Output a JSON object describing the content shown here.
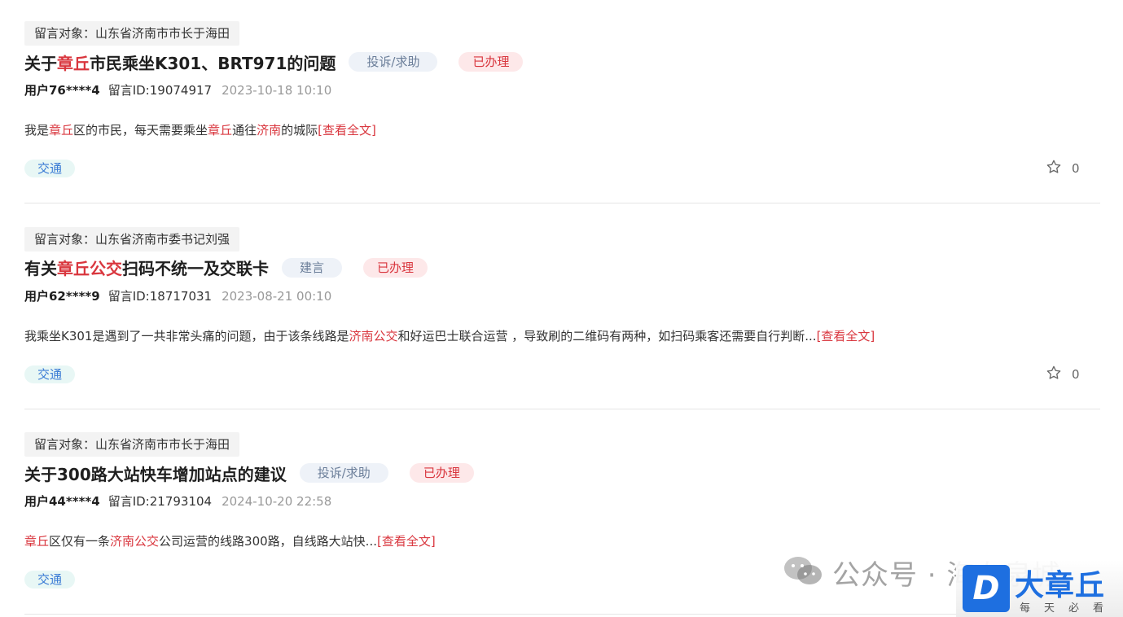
{
  "posts": [
    {
      "target": "留言对象：山东省济南市市长于海田",
      "title": [
        {
          "t": "关于",
          "hl": false
        },
        {
          "t": "章丘",
          "hl": true
        },
        {
          "t": "市民乘坐K301、BRT971的问题",
          "hl": false
        }
      ],
      "type": "投诉/求助",
      "status": "已办理",
      "user": "用户76****4",
      "msg_id": "留言ID:19074917",
      "time": "2023-10-18 10:10",
      "content": [
        {
          "t": "我是",
          "hl": false
        },
        {
          "t": "章丘",
          "hl": true
        },
        {
          "t": "区的市民，每天需要乘坐",
          "hl": false
        },
        {
          "t": "章丘",
          "hl": true
        },
        {
          "t": "通往",
          "hl": false
        },
        {
          "t": "济南",
          "hl": true
        },
        {
          "t": "的城际",
          "hl": false
        }
      ],
      "more": "[查看全文]",
      "category": "交通",
      "favorites": "0"
    },
    {
      "target": "留言对象：山东省济南市委书记刘强",
      "title": [
        {
          "t": "有关",
          "hl": false
        },
        {
          "t": "章丘公交",
          "hl": true
        },
        {
          "t": "扫码不统一及交联卡",
          "hl": false
        }
      ],
      "type": "建言",
      "status": "已办理",
      "user": "用户62****9",
      "msg_id": "留言ID:18717031",
      "time": "2023-08-21 00:10",
      "content": [
        {
          "t": "我乘坐K301是遇到了一共非常头痛的问题，由于该条线路是",
          "hl": false
        },
        {
          "t": "济南公交",
          "hl": true
        },
        {
          "t": "和好运巴士联合运营 ，导致刷的二维码有两种，如扫码乘客还需要自行判断...",
          "hl": false
        }
      ],
      "more": "[查看全文]",
      "category": "交通",
      "favorites": "0"
    },
    {
      "target": "留言对象：山东省济南市市长于海田",
      "title": [
        {
          "t": "关于300路大站快车增加站点的建议",
          "hl": false
        }
      ],
      "type": "投诉/求助",
      "status": "已办理",
      "user": "用户44****4",
      "msg_id": "留言ID:21793104",
      "time": "2024-10-20 22:58",
      "content": [
        {
          "t": "章丘",
          "hl": true
        },
        {
          "t": "区仅有一条",
          "hl": false
        },
        {
          "t": "济南公交",
          "hl": true
        },
        {
          "t": "公司运营的线路300路，自线路大站快...",
          "hl": false
        }
      ],
      "more": "[查看全文]",
      "category": "交通",
      "favorites": null
    }
  ],
  "watermark": {
    "text": "公众号 · 海右泉城",
    "brand": "大章丘",
    "brand_logo": "D",
    "slogan": "每天必看",
    "icon": "wechat-icon"
  },
  "colors": {
    "highlight": "#d9363e",
    "type_tag_bg": "#eef2f8",
    "status_tag_bg": "#fde8e9",
    "category_bg": "#e8f7f5",
    "brand": "#1e6fe0"
  }
}
